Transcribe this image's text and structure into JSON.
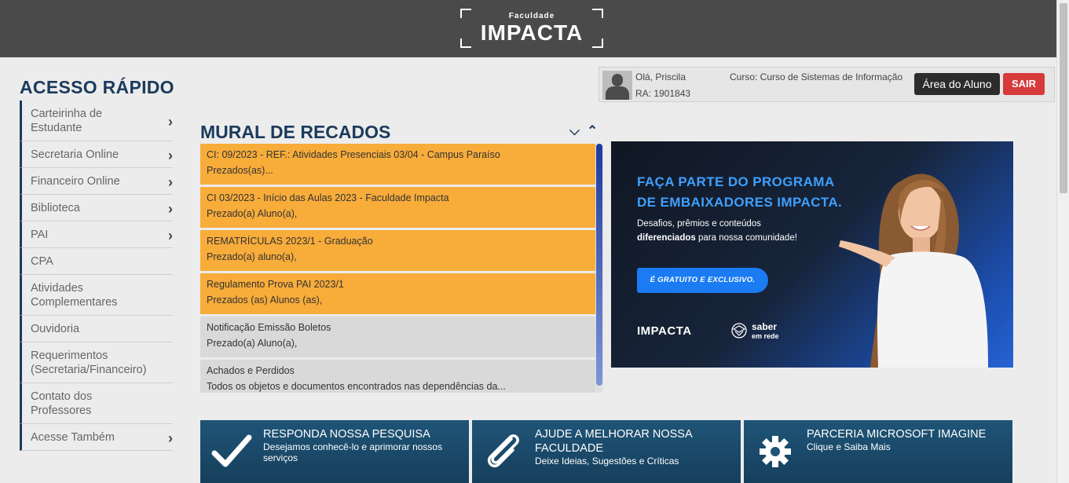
{
  "header": {
    "logo_small": "Faculdade",
    "logo_big": "IMPACTA"
  },
  "quick_access": {
    "title": "ACESSO RÁPIDO",
    "items": [
      {
        "label": "Carteirinha de Estudante",
        "has_arrow": true
      },
      {
        "label": "Secretaria Online",
        "has_arrow": true
      },
      {
        "label": "Financeiro Online",
        "has_arrow": true
      },
      {
        "label": "Biblioteca",
        "has_arrow": true
      },
      {
        "label": "PAI",
        "has_arrow": true
      },
      {
        "label": "CPA",
        "has_arrow": false
      },
      {
        "label": "Atividades Complementares",
        "has_arrow": false
      },
      {
        "label": "Ouvidoria",
        "has_arrow": false
      },
      {
        "label": "Requerimentos (Secretaria/Financeiro)",
        "has_arrow": false
      },
      {
        "label": "Contato dos Professores",
        "has_arrow": false
      },
      {
        "label": "Acesse Também",
        "has_arrow": true
      }
    ]
  },
  "user": {
    "greeting": "Olá, Priscila",
    "ra": "RA: 1901843",
    "course": "Curso: Curso de Sistemas de Informação",
    "area_button": "Área do Aluno",
    "logout_button": "SAIR"
  },
  "mural": {
    "title": "MURAL DE RECADOS",
    "notices": [
      {
        "title": "CI: 09/2023 - REF.: Atividades Presenciais 03/04 - Campus Paraíso",
        "summary": "Prezados(as)...",
        "color": "orange"
      },
      {
        "title": "CI 03/2023 - Início das Aulas 2023 - Faculdade Impacta",
        "summary": "Prezado(a) Aluno(a),",
        "color": "orange"
      },
      {
        "title": "REMATRÍCULAS 2023/1 - Graduação",
        "summary": "Prezado(a) aluno(a),",
        "color": "orange"
      },
      {
        "title": "Regulamento Prova PAI 2023/1",
        "summary": "Prezados (as) Alunos (as),",
        "color": "orange"
      },
      {
        "title": "Notificação Emissão Boletos",
        "summary": "Prezado(a) Aluno(a),",
        "color": "gray"
      },
      {
        "title": "Achados e Perdidos",
        "summary": "Todos os objetos e documentos encontrados nas dependências da...",
        "color": "gray"
      }
    ]
  },
  "banner": {
    "headline_1": "FAÇA PARTE DO PROGRAMA",
    "headline_2": "DE EMBAIXADORES IMPACTA.",
    "text_1": "Desafios, prêmios e conteúdos",
    "text_2_bold": "diferenciados",
    "text_2_rest": " para nossa comunidade!",
    "pill": "É GRATUITO E EXCLUSIVO.",
    "logo": "IMPACTA",
    "saber_1": "saber",
    "saber_2": "em rede"
  },
  "cards": [
    {
      "title": "RESPONDA NOSSA PESQUISA",
      "subtitle": "Desejamos conhecê-lo e aprimorar nossos serviços",
      "icon": "check-icon"
    },
    {
      "title": "AJUDE A MELHORAR NOSSA FACULDADE",
      "subtitle": "Deixe Ideias, Sugestões e Críticas",
      "icon": "paperclip-icon"
    },
    {
      "title": "PARCERIA MICROSOFT IMAGINE",
      "subtitle": "Clique e Saiba Mais",
      "icon": "gear-icon"
    }
  ],
  "colors": {
    "navy": "#1b3a5c",
    "orange": "#f8ac3a",
    "header": "#4a4a4a",
    "card": "#1f5477",
    "logout": "#d63a3a"
  }
}
